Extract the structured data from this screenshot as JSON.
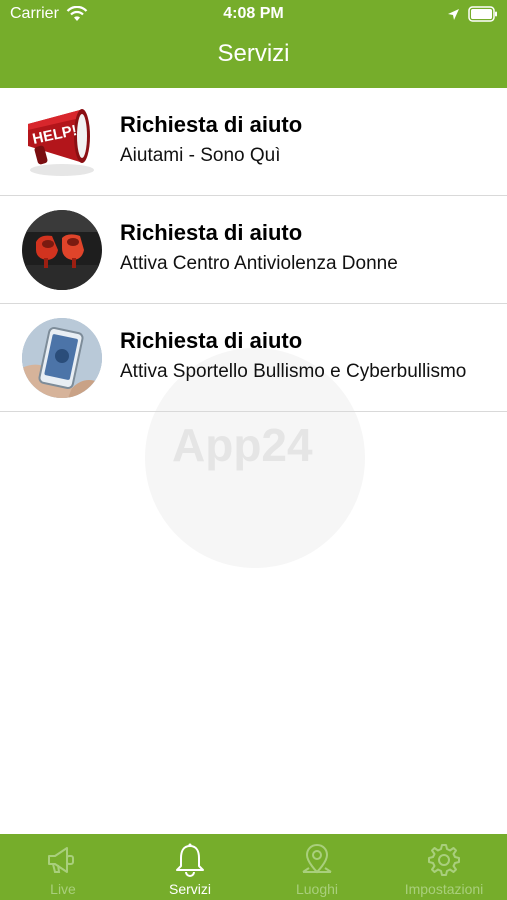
{
  "status_bar": {
    "carrier": "Carrier",
    "time": "4:08 PM"
  },
  "nav": {
    "title": "Servizi"
  },
  "services": [
    {
      "title": "Richiesta di aiuto",
      "subtitle": "Aiutami - Sono Quì",
      "thumb_icon": "help-megaphone-icon",
      "thumb_text": "HELP!"
    },
    {
      "title": "Richiesta di aiuto",
      "subtitle": "Attiva Centro Antiviolenza Donne",
      "thumb_icon": "red-shoes-photo"
    },
    {
      "title": "Richiesta di aiuto",
      "subtitle": "Attiva Sportello Bullismo e Cyberbullismo",
      "thumb_icon": "phone-hand-photo"
    }
  ],
  "watermark": {
    "text": "App24"
  },
  "tabbar": {
    "items": [
      {
        "label": "Live",
        "icon": "megaphone-icon",
        "active": false
      },
      {
        "label": "Servizi",
        "icon": "bell-icon",
        "active": true
      },
      {
        "label": "Luoghi",
        "icon": "map-pin-icon",
        "active": false
      },
      {
        "label": "Impostazioni",
        "icon": "gear-icon",
        "active": false
      }
    ]
  },
  "colors": {
    "brand_green": "#76ad2b",
    "inactive_tab": "#a9cf7c"
  }
}
